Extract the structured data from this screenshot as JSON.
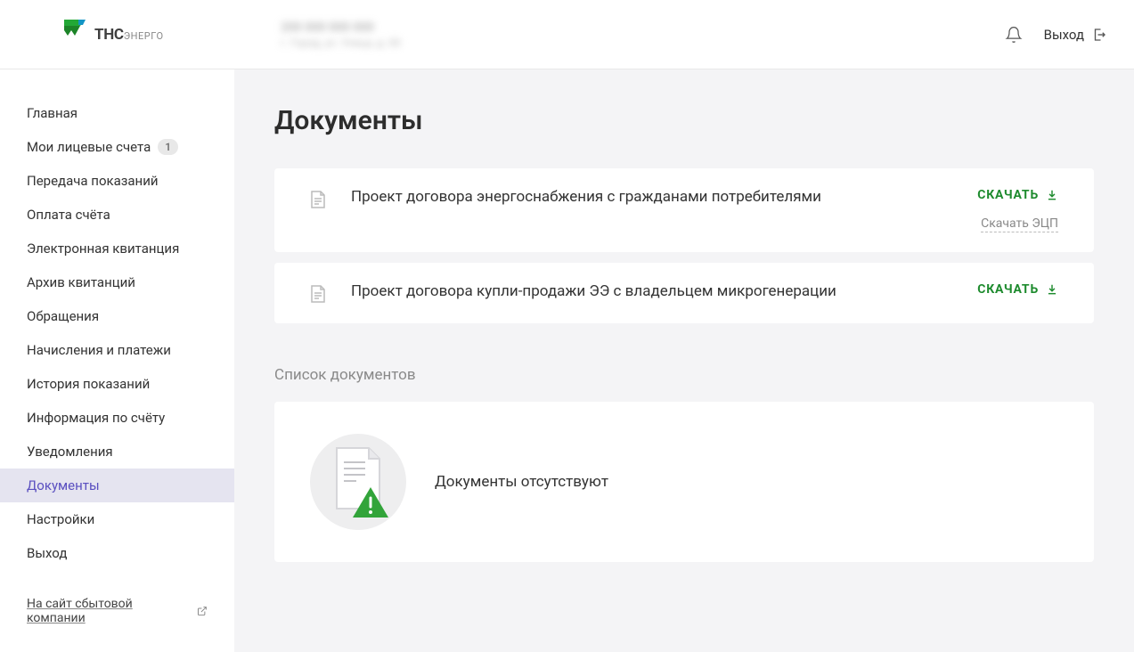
{
  "brand": {
    "main": "ТНС",
    "sub": "ЭНЕРГО"
  },
  "account": {
    "number": "200 000 000 000",
    "address": "г. Город, ул. Улица, д. 00"
  },
  "header": {
    "exit_label": "Выход"
  },
  "sidebar": {
    "items": [
      {
        "label": "Главная",
        "name": "main"
      },
      {
        "label": "Мои лицевые счета",
        "name": "accounts",
        "badge": "1"
      },
      {
        "label": "Передача показаний",
        "name": "readings-submit"
      },
      {
        "label": "Оплата счёта",
        "name": "payment"
      },
      {
        "label": "Электронная квитанция",
        "name": "e-receipt"
      },
      {
        "label": "Архив квитанций",
        "name": "receipt-archive"
      },
      {
        "label": "Обращения",
        "name": "appeals"
      },
      {
        "label": "Начисления и платежи",
        "name": "charges"
      },
      {
        "label": "История показаний",
        "name": "readings-history"
      },
      {
        "label": "Информация по счёту",
        "name": "account-info"
      },
      {
        "label": "Уведомления",
        "name": "notifications"
      },
      {
        "label": "Документы",
        "name": "documents"
      },
      {
        "label": "Настройки",
        "name": "settings"
      },
      {
        "label": "Выход",
        "name": "logout"
      }
    ],
    "footer_link": "На сайт сбытовой компании"
  },
  "page": {
    "title": "Документы",
    "download_label": "СКАЧАТЬ",
    "download_ecp_label": "Скачать ЭЦП",
    "list_label": "Список документов",
    "empty_message": "Документы отсутствуют"
  },
  "documents": [
    {
      "title": "Проект договора энергоснабжения с гражданами потребителями",
      "has_ecp": true
    },
    {
      "title": "Проект договора купли-продажи ЭЭ с владельцем микрогенерации",
      "has_ecp": false
    }
  ]
}
